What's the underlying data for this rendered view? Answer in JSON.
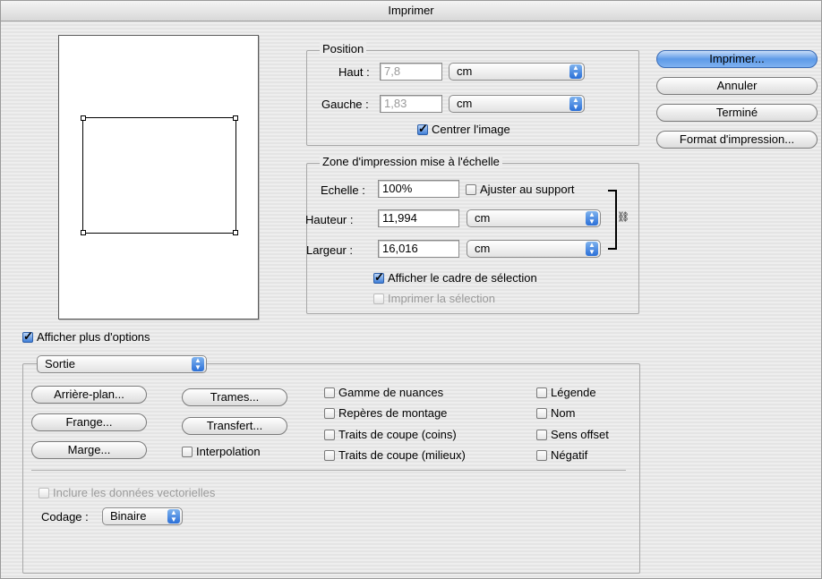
{
  "window": {
    "title": "Imprimer"
  },
  "position": {
    "legend": "Position",
    "haut_label": "Haut :",
    "haut_value": "7,8",
    "haut_unit": "cm",
    "gauche_label": "Gauche :",
    "gauche_value": "1,83",
    "gauche_unit": "cm",
    "centrer_label": "Centrer l'image",
    "centrer_checked": true
  },
  "zone": {
    "legend": "Zone d'impression mise à l'échelle",
    "echelle_label": "Echelle :",
    "echelle_value": "100%",
    "ajuster_label": "Ajuster au support",
    "hauteur_label": "Hauteur :",
    "hauteur_value": "11,994",
    "hauteur_unit": "cm",
    "largeur_label": "Largeur :",
    "largeur_value": "16,016",
    "largeur_unit": "cm",
    "afficher_cadre_label": "Afficher le cadre de sélection",
    "imprimer_selection_label": "Imprimer la sélection"
  },
  "buttons": {
    "imprimer": "Imprimer...",
    "annuler": "Annuler",
    "termine": "Terminé",
    "format": "Format d'impression..."
  },
  "options": {
    "afficher_plus_label": "Afficher plus d'options",
    "sortie_value": "Sortie",
    "arriere_plan": "Arrière-plan...",
    "trames": "Trames...",
    "frange": "Frange...",
    "transfert": "Transfert...",
    "marge": "Marge...",
    "interpolation": "Interpolation",
    "gamme": "Gamme de nuances",
    "reperes": "Repères de montage",
    "traits_coins": "Traits de coupe (coins)",
    "traits_milieux": "Traits de coupe (milieux)",
    "legende": "Légende",
    "nom": "Nom",
    "sens_offset": "Sens offset",
    "negatif": "Négatif",
    "inclure_vect": "Inclure les données vectorielles",
    "codage_label": "Codage :",
    "codage_value": "Binaire"
  },
  "icons": {
    "link": "chain-link-icon",
    "popup": "updown-arrows-icon"
  }
}
